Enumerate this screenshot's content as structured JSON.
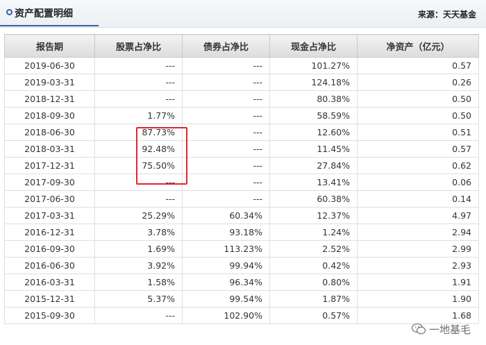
{
  "header": {
    "title": "资产配置明细",
    "source": "来源：天天基金"
  },
  "table": {
    "columns": [
      "报告期",
      "股票占净比",
      "债券占净比",
      "现金占净比",
      "净资产（亿元）"
    ],
    "rows": [
      [
        "2019-06-30",
        "---",
        "---",
        "101.27%",
        "0.57"
      ],
      [
        "2019-03-31",
        "---",
        "---",
        "124.18%",
        "0.26"
      ],
      [
        "2018-12-31",
        "---",
        "---",
        "80.38%",
        "0.50"
      ],
      [
        "2018-09-30",
        "1.77%",
        "---",
        "58.59%",
        "0.50"
      ],
      [
        "2018-06-30",
        "87.73%",
        "---",
        "12.60%",
        "0.51"
      ],
      [
        "2018-03-31",
        "92.48%",
        "---",
        "11.45%",
        "0.57"
      ],
      [
        "2017-12-31",
        "75.50%",
        "---",
        "27.84%",
        "0.62"
      ],
      [
        "2017-09-30",
        "---",
        "---",
        "13.41%",
        "0.06"
      ],
      [
        "2017-06-30",
        "---",
        "---",
        "60.38%",
        "0.14"
      ],
      [
        "2017-03-31",
        "25.29%",
        "60.34%",
        "12.37%",
        "4.97"
      ],
      [
        "2016-12-31",
        "3.78%",
        "93.18%",
        "1.24%",
        "2.94"
      ],
      [
        "2016-09-30",
        "1.69%",
        "113.23%",
        "2.52%",
        "2.99"
      ],
      [
        "2016-06-30",
        "3.92%",
        "99.94%",
        "0.42%",
        "2.93"
      ],
      [
        "2016-03-31",
        "1.58%",
        "96.34%",
        "0.80%",
        "1.91"
      ],
      [
        "2015-12-31",
        "5.37%",
        "99.54%",
        "1.87%",
        "1.90"
      ],
      [
        "2015-09-30",
        "---",
        "102.90%",
        "0.57%",
        "1.68"
      ]
    ]
  },
  "watermark": {
    "text": "一地基毛",
    "icon": "wechat-icon"
  },
  "colors": {
    "accent": "#2f62a8",
    "highlight": "#e0252b"
  }
}
